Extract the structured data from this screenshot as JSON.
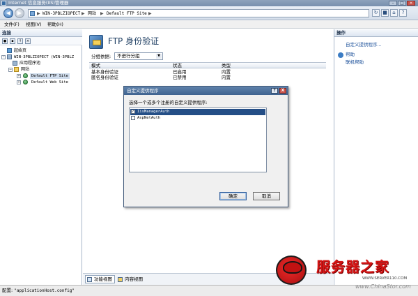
{
  "window": {
    "title": "Internet 信息服务(IIS)管理器"
  },
  "address_bar": {
    "crumbs": [
      "WIN-3PBLZIOPECT",
      "网站",
      "Default FTP Site"
    ],
    "separator": "▶"
  },
  "menu": {
    "items": [
      "文件(F)",
      "视图(V)",
      "帮助(H)"
    ]
  },
  "connections": {
    "header": "连接",
    "tree": [
      {
        "label": "起始页",
        "level": 1,
        "icon": "home-icon"
      },
      {
        "label": "WIN-3PBLZIOPECT (WIN-3PBLZ",
        "level": 1,
        "icon": "server-icon",
        "expanded": true
      },
      {
        "label": "应用程序池",
        "level": 2,
        "icon": "app-pool-icon"
      },
      {
        "label": "网站",
        "level": 2,
        "icon": "folder-icon",
        "expanded": true
      },
      {
        "label": "Default FTP Site",
        "level": 3,
        "icon": "globe-icon",
        "selected": true
      },
      {
        "label": "Default Web Site",
        "level": 3,
        "icon": "globe-icon"
      }
    ]
  },
  "center": {
    "title": "FTP 身份验证",
    "group_by_label": "分组依据:",
    "group_by_value": "不进行分组",
    "columns": [
      "模式",
      "状态",
      "类型"
    ],
    "rows": [
      {
        "mode": "基本身份验证",
        "status": "已启用",
        "type": "内置"
      },
      {
        "mode": "匿名身份验证",
        "status": "已禁用",
        "type": "内置"
      }
    ],
    "tabs": {
      "features": "功能视图",
      "content": "内容视图"
    }
  },
  "actions": {
    "header": "操作",
    "items": [
      "自定义提供程序...",
      "帮助",
      "联机帮助"
    ]
  },
  "status_bar": {
    "label": "配置:",
    "value": "\"applicationHost.config\""
  },
  "dialog": {
    "title": "自定义提供程序",
    "help_button": "?",
    "close_button": "X",
    "instruction": "选择一个或多个注册的自定义提供程序:",
    "providers": [
      {
        "name": "IisManagerAuth",
        "checked": true,
        "selected": true
      },
      {
        "name": "AspNetAuth",
        "checked": false,
        "selected": false
      }
    ],
    "ok_label": "确定",
    "cancel_label": "取消"
  },
  "watermark": {
    "name": "服务器之家",
    "url1": "WWW.SERVER110.COM",
    "url2": "www.ChinaStor.com"
  },
  "colors": {
    "titlebar": "#7890ae",
    "link": "#1a4f99",
    "selection": "#244e86",
    "watermark_red": "#d41414"
  }
}
